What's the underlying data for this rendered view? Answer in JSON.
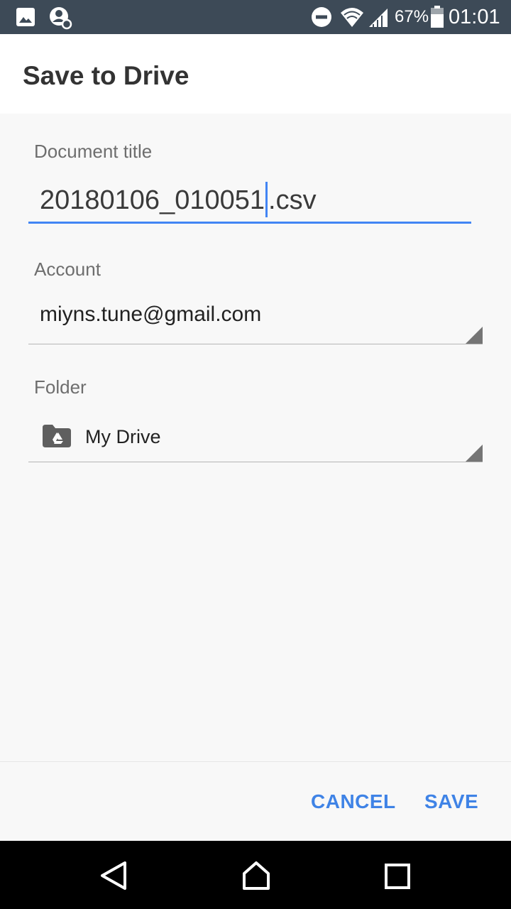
{
  "status_bar": {
    "left_icons": [
      "image-notification-icon",
      "account-sync-icon"
    ],
    "right_icons": [
      "do-not-disturb-icon",
      "wifi-icon",
      "signal-icon",
      "battery-icon"
    ],
    "battery_percent": "67%",
    "time": "01:01"
  },
  "dialog": {
    "title": "Save to Drive",
    "document_title": {
      "label": "Document title",
      "value_before_caret": "20180106_010051",
      "value_after_caret": ".csv"
    },
    "account": {
      "label": "Account",
      "value": "miyns.tune@gmail.com"
    },
    "folder": {
      "label": "Folder",
      "value": "My Drive",
      "icon": "drive-folder-icon"
    },
    "buttons": {
      "cancel": "CANCEL",
      "save": "SAVE"
    }
  },
  "colors": {
    "status_bar": "#3d4a57",
    "accent": "#4285f4",
    "button_text": "#3f83e6",
    "background": "#f8f8f8"
  },
  "nav_bar": [
    "back-icon",
    "home-icon",
    "recents-icon"
  ]
}
